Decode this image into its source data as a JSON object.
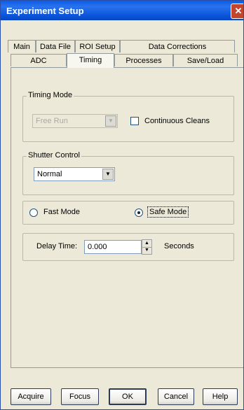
{
  "window": {
    "title": "Experiment Setup",
    "close_glyph": "✕"
  },
  "tabs": {
    "row1": [
      "Main",
      "Data File",
      "ROI Setup",
      "Data Corrections"
    ],
    "row2": [
      "ADC",
      "Timing",
      "Processes",
      "Save/Load"
    ],
    "active": "Timing"
  },
  "timing_mode": {
    "legend": "Timing Mode",
    "mode_value": "Free Run",
    "continuous_cleans_label": "Continuous Cleans",
    "continuous_cleans_checked": false
  },
  "shutter_control": {
    "legend": "Shutter Control",
    "value": "Normal"
  },
  "mode_select": {
    "fast_label": "Fast Mode",
    "safe_label": "Safe Mode",
    "selected": "Safe Mode"
  },
  "delay": {
    "label": "Delay Time:",
    "value": "0.000",
    "unit": "Seconds"
  },
  "buttons": {
    "acquire": "Acquire",
    "focus": "Focus",
    "ok": "OK",
    "cancel": "Cancel",
    "help": "Help"
  }
}
